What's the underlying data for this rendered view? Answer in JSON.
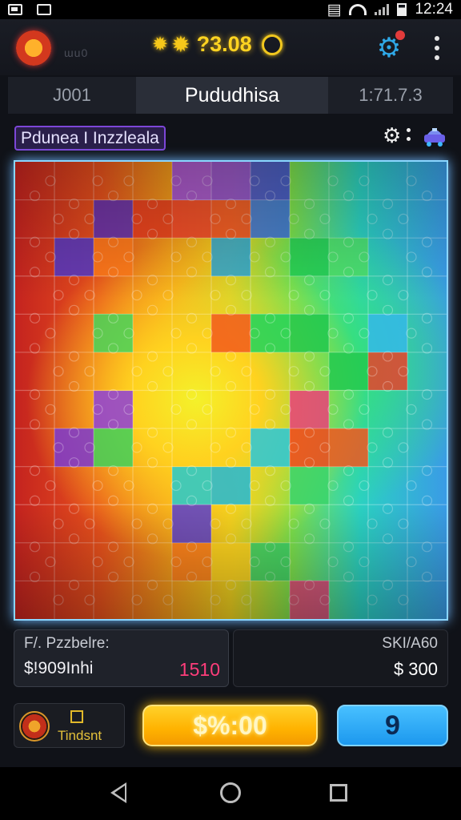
{
  "status_bar": {
    "time": "12:24"
  },
  "header": {
    "logo_subtext": "ɯu0",
    "coin_value": "?3.08",
    "accent_color": "#ffd321"
  },
  "tabs": [
    {
      "label": "J001",
      "active": false
    },
    {
      "label": "Pududhisa",
      "active": true
    },
    {
      "label": "1:71.7.3",
      "active": false
    }
  ],
  "puzzle": {
    "title": "Pdunea I Inzzleala",
    "tiles": [
      {
        "col": 4,
        "row": 0,
        "color": "#9d4be8"
      },
      {
        "col": 5,
        "row": 0,
        "color": "#8a43e2"
      },
      {
        "col": 6,
        "row": 0,
        "color": "#3f49d8"
      },
      {
        "col": 4,
        "row": 1,
        "color": "#f0402a"
      },
      {
        "col": 3,
        "row": 1,
        "color": "#e8391f"
      },
      {
        "col": 2,
        "row": 1,
        "color": "#5a2fb8"
      },
      {
        "col": 6,
        "row": 1,
        "color": "#3b6fe0"
      },
      {
        "col": 5,
        "row": 1,
        "color": "#f14a26"
      },
      {
        "col": 1,
        "row": 2,
        "color": "#5138c9"
      },
      {
        "col": 5,
        "row": 2,
        "color": "#2ba6d6"
      },
      {
        "col": 7,
        "row": 2,
        "color": "#23cf54"
      },
      {
        "col": 2,
        "row": 2,
        "color": "#ff7a1a"
      },
      {
        "col": 8,
        "row": 2,
        "color": "#4fe068"
      },
      {
        "col": 2,
        "row": 4,
        "color": "#47d45a"
      },
      {
        "col": 5,
        "row": 4,
        "color": "#f25b1c"
      },
      {
        "col": 6,
        "row": 4,
        "color": "#21d45a"
      },
      {
        "col": 7,
        "row": 4,
        "color": "#20c84e"
      },
      {
        "col": 9,
        "row": 4,
        "color": "#35b8e8"
      },
      {
        "col": 9,
        "row": 5,
        "color": "#e8422a"
      },
      {
        "col": 8,
        "row": 5,
        "color": "#23c94f"
      },
      {
        "col": 2,
        "row": 6,
        "color": "#8d3fd9"
      },
      {
        "col": 7,
        "row": 6,
        "color": "#e8417a"
      },
      {
        "col": 1,
        "row": 7,
        "color": "#7b3ad0"
      },
      {
        "col": 2,
        "row": 7,
        "color": "#3fd05a"
      },
      {
        "col": 6,
        "row": 7,
        "color": "#2ac7d9"
      },
      {
        "col": 8,
        "row": 7,
        "color": "#f1561e"
      },
      {
        "col": 7,
        "row": 7,
        "color": "#f1461c"
      },
      {
        "col": 4,
        "row": 8,
        "color": "#25c9cf"
      },
      {
        "col": 5,
        "row": 8,
        "color": "#22b9d6"
      },
      {
        "col": 7,
        "row": 8,
        "color": "#3ad36b"
      },
      {
        "col": 4,
        "row": 9,
        "color": "#5a3ed0"
      },
      {
        "col": 6,
        "row": 10,
        "color": "#3bd468"
      },
      {
        "col": 7,
        "row": 11,
        "color": "#e8417a"
      },
      {
        "col": 4,
        "row": 10,
        "color": "#ff7c1b"
      },
      {
        "col": 5,
        "row": 10,
        "color": "#ffd31e"
      }
    ]
  },
  "stats": {
    "left_label": "F/. Pzzbelre:",
    "left_value": "$!909Inhi",
    "left_accent": "1510",
    "right_label": "SKI/A60",
    "right_value": "$ 300"
  },
  "controls": {
    "trophy_label": "Tindsnt",
    "play_label": "$%:00",
    "count_label": "9"
  }
}
